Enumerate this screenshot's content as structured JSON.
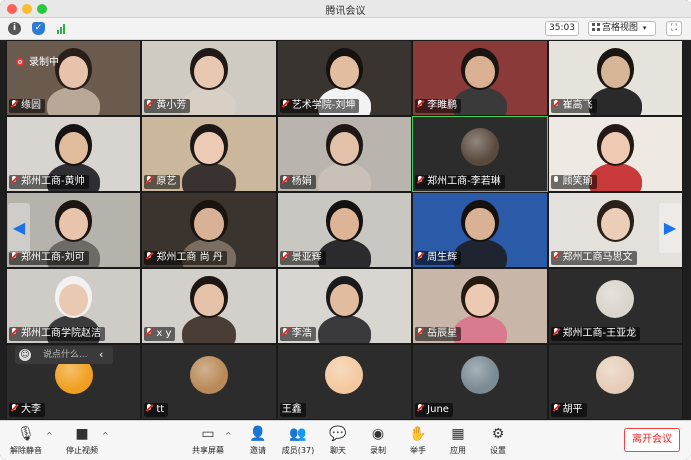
{
  "window": {
    "title": "腾讯会议"
  },
  "topbar": {
    "timer": "35:03",
    "view_label": "宫格视图"
  },
  "recording": {
    "label": "录制中"
  },
  "chat": {
    "placeholder": "说点什么..."
  },
  "participants": [
    {
      "name": "缘圆",
      "kind": "video",
      "bg": "#6b5a4e",
      "skin": "#e8c3ab",
      "hair": "#2a1e1a",
      "shirt": "#b8a898"
    },
    {
      "name": "黄小芳",
      "kind": "video",
      "bg": "#cfcac2",
      "skin": "#e9c8b2",
      "hair": "#1f1a17",
      "shirt": "#d8cfc5"
    },
    {
      "name": "艺术学院-刘坤",
      "kind": "video",
      "bg": "#3a3430",
      "skin": "#e2bda0",
      "hair": "#16120f",
      "shirt": "#f2f2f2"
    },
    {
      "name": "李睢鹏",
      "kind": "video",
      "bg": "#8b3a3a",
      "skin": "#d9b092",
      "hair": "#1a1512",
      "shirt": "#3a3a3a"
    },
    {
      "name": "崔高飞",
      "kind": "video",
      "bg": "#e6e2dc",
      "skin": "#d7b597",
      "hair": "#1a1612",
      "shirt": "#2a2a2a"
    },
    {
      "name": "郑州工商-黄帅",
      "kind": "video",
      "bg": "#d8d4cf",
      "skin": "#e0bb9c",
      "hair": "#151211",
      "shirt": "#2e2e33"
    },
    {
      "name": "原艺",
      "kind": "video",
      "bg": "#cbb79c",
      "skin": "#eccab4",
      "hair": "#1d1715",
      "shirt": "#3a3230"
    },
    {
      "name": "杨娟",
      "kind": "video",
      "bg": "#b9b5ae",
      "skin": "#e3c1a8",
      "hair": "#1d1816",
      "shirt": "#c9c1b8"
    },
    {
      "name": "郑州工商-李若琳",
      "kind": "avatar",
      "active": true,
      "bg": "#2c2c2c",
      "avatar": "#5a4a3e"
    },
    {
      "name": "顾笑瑜",
      "kind": "video",
      "bg": "#efe9e4",
      "skin": "#efc9b2",
      "hair": "#231a16",
      "shirt": "#c83a3a",
      "mic_on": true
    },
    {
      "name": "郑州工商-刘可",
      "kind": "video",
      "bg": "#b6b2ac",
      "skin": "#e9c4ad",
      "hair": "#1c1613",
      "shirt": "#6e6a66"
    },
    {
      "name": "郑州工商 尚 丹",
      "kind": "video",
      "bg": "#3a332e",
      "skin": "#d9b196",
      "hair": "#1a1411",
      "shirt": "#7a6e62"
    },
    {
      "name": "景亚辉",
      "kind": "video",
      "bg": "#c9c7c2",
      "skin": "#deb497",
      "hair": "#141110",
      "shirt": "#2b2b2e"
    },
    {
      "name": "周生辉",
      "kind": "video",
      "bg": "#2a5aa8",
      "skin": "#d9b195",
      "hair": "#141110",
      "shirt": "#1e2430"
    },
    {
      "name": "郑州工商马思文",
      "kind": "video",
      "bg": "#e4e0db",
      "skin": "#eccdb8",
      "hair": "#2b1f19",
      "shirt": "#e4e0db"
    },
    {
      "name": "郑州工商学院赵洁",
      "kind": "video",
      "bg": "#cfcbc6",
      "skin": "#eac9b3",
      "hair": "#f2f2f2",
      "shirt": "#3b3b3b"
    },
    {
      "name": "x y",
      "kind": "video",
      "bg": "#d3d0cc",
      "skin": "#e6c2a9",
      "hair": "#1c1512",
      "shirt": "#4a3d36"
    },
    {
      "name": "李浩",
      "kind": "video",
      "bg": "#d9d6d2",
      "skin": "#e2bc9f",
      "hair": "#1b1b1d",
      "shirt": "#3a3a3d"
    },
    {
      "name": "岳辰星",
      "kind": "video",
      "bg": "#c8b6a8",
      "skin": "#ecc9b3",
      "hair": "#24190f",
      "shirt": "#d97a8e"
    },
    {
      "name": "郑州工商-王亚龙",
      "kind": "avatar",
      "bg": "#2c2c2c",
      "avatar": "#d9d4cc"
    },
    {
      "name": "大李",
      "kind": "avatar",
      "bg": "#2c2c2c",
      "avatar": "#f0a020"
    },
    {
      "name": "tt",
      "kind": "avatar",
      "bg": "#2c2c2c",
      "avatar": "#b98a58"
    },
    {
      "name": "王鑫",
      "kind": "avatar",
      "bg": "#2c2c2c",
      "avatar": "#f4c9a0",
      "no_mic": true
    },
    {
      "name": "June",
      "kind": "avatar",
      "bg": "#2c2c2c",
      "avatar": "#7b8a94"
    },
    {
      "name": "胡平",
      "kind": "avatar",
      "bg": "#2c2c2c",
      "avatar": "#e6cdb8"
    }
  ],
  "toolbar": {
    "unmute": "解除静音",
    "stop_video": "停止视频",
    "share": "共享屏幕",
    "invite": "邀请",
    "members": "成员(37)",
    "chat": "聊天",
    "record": "录制",
    "raise_hand": "举手",
    "apps": "应用",
    "settings": "设置",
    "leave": "离开会议"
  }
}
